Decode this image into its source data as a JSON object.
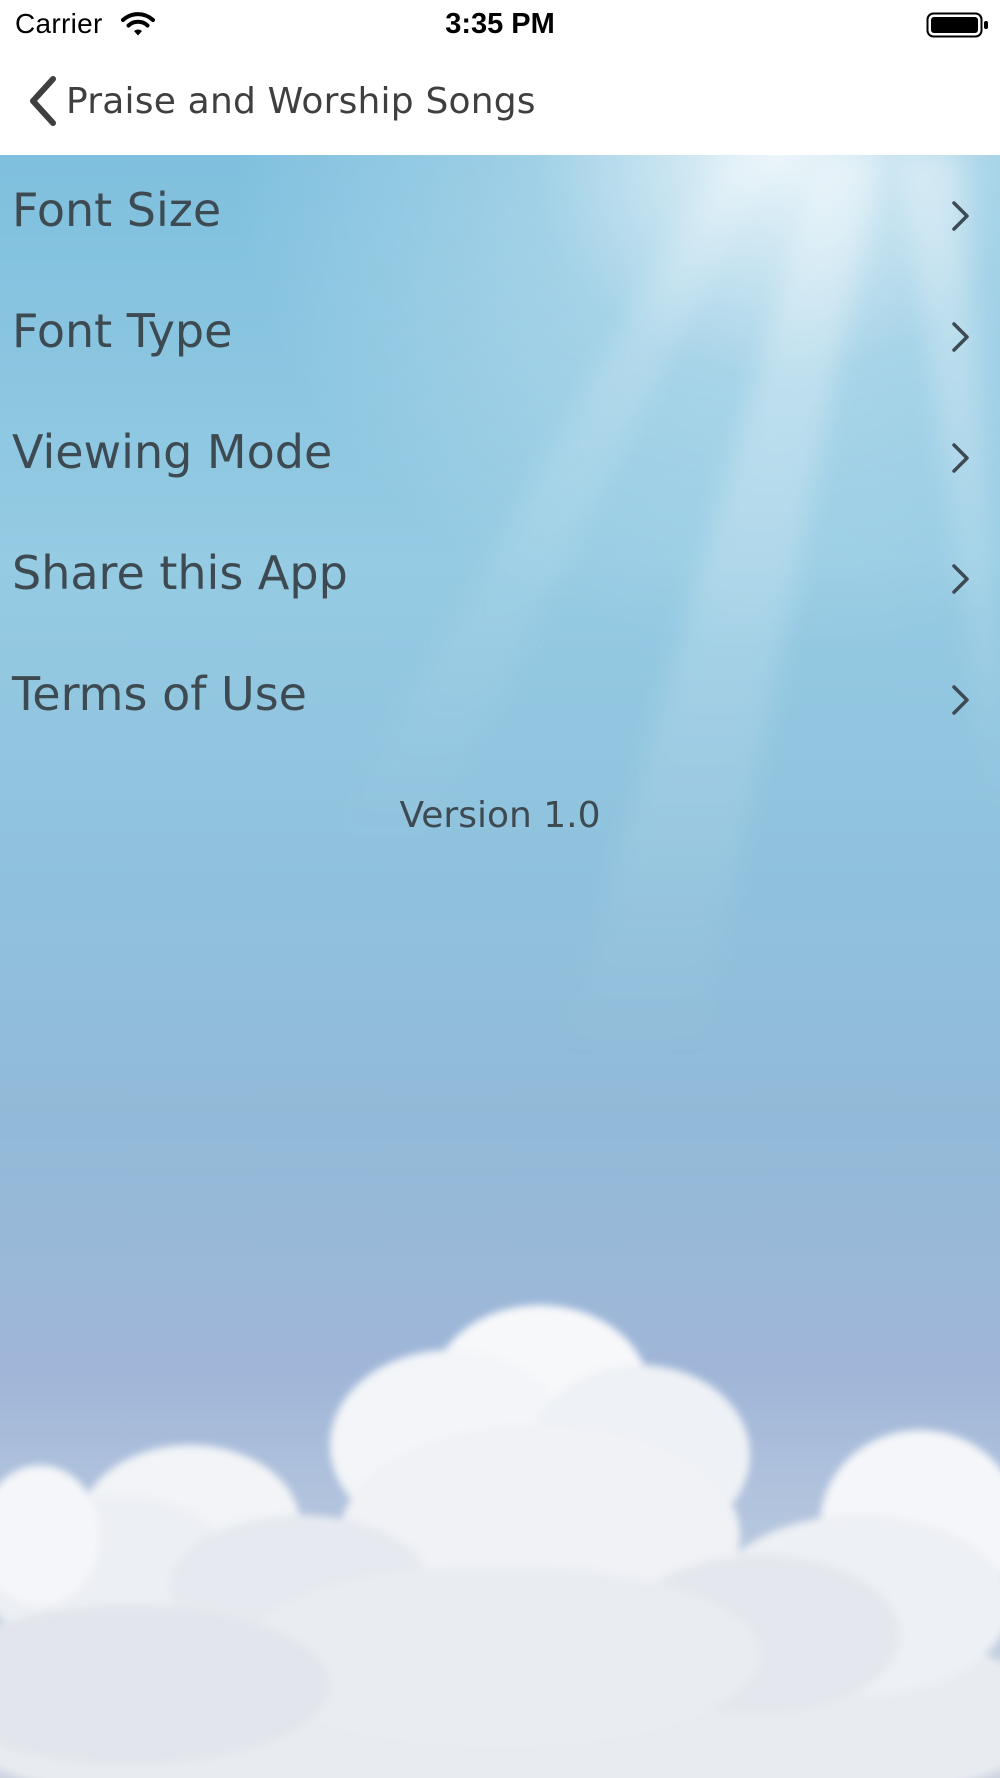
{
  "status_bar": {
    "carrier": "Carrier",
    "time": "3:35 PM",
    "wifi_icon": "wifi-icon",
    "battery_icon": "battery-full-icon"
  },
  "nav": {
    "back_label": "Praise and Worship Songs",
    "back_icon": "chevron-left-icon"
  },
  "menu": {
    "items": [
      {
        "label": "Font Size",
        "icon": "chevron-right-icon"
      },
      {
        "label": "Font Type",
        "icon": "chevron-right-icon"
      },
      {
        "label": "Viewing Mode",
        "icon": "chevron-right-icon"
      },
      {
        "label": "Share this App",
        "icon": "chevron-right-icon"
      },
      {
        "label": "Terms of Use",
        "icon": "chevron-right-icon"
      }
    ]
  },
  "footer": {
    "version": "Version 1.0"
  },
  "colors": {
    "text": "#3e4a52",
    "sky_top": "#7fc0de",
    "sky_bottom": "#cfd6e2",
    "bar_background": "#ffffff"
  }
}
